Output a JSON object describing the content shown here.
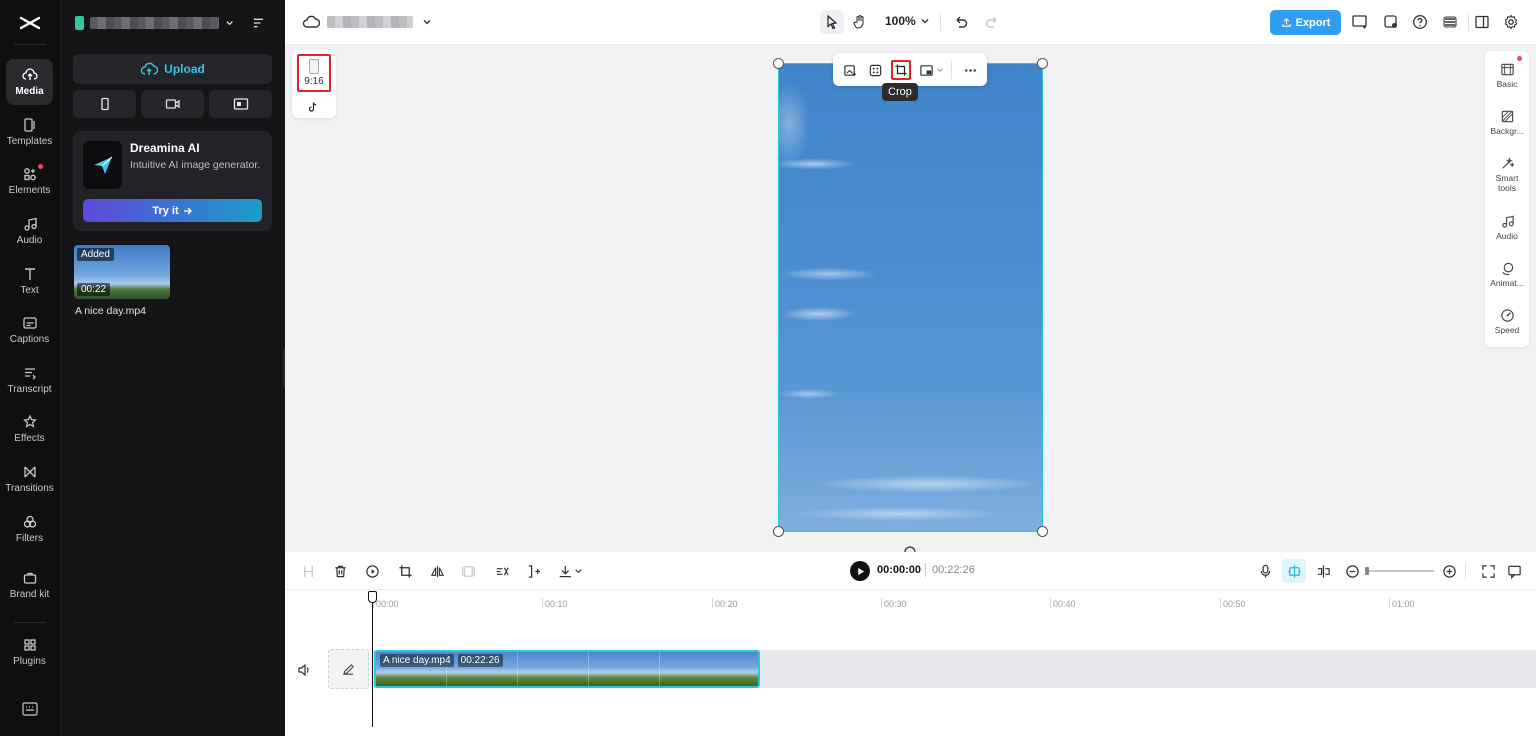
{
  "rail": {
    "items": [
      {
        "label": "Media",
        "icon": "cloud-upload-icon"
      },
      {
        "label": "Templates",
        "icon": "templates-icon"
      },
      {
        "label": "Elements",
        "icon": "elements-icon"
      },
      {
        "label": "Audio",
        "icon": "music-note-icon"
      },
      {
        "label": "Text",
        "icon": "text-icon"
      },
      {
        "label": "Captions",
        "icon": "captions-icon"
      },
      {
        "label": "Transcript",
        "icon": "transcript-icon"
      },
      {
        "label": "Effects",
        "icon": "effects-icon"
      },
      {
        "label": "Transitions",
        "icon": "transitions-icon"
      },
      {
        "label": "Filters",
        "icon": "filters-icon"
      },
      {
        "label": "Brand kit",
        "icon": "brand-kit-icon"
      },
      {
        "label": "Plugins",
        "icon": "plugins-icon"
      }
    ]
  },
  "panel": {
    "upload_label": "Upload",
    "promo": {
      "title": "Dreamina AI",
      "subtitle": "Intuitive AI image generator.",
      "button": "Try it"
    },
    "media": {
      "badge": "Added",
      "duration": "00:22",
      "name": "A nice day.mp4"
    }
  },
  "topbar": {
    "zoom": "100%",
    "export_label": "Export"
  },
  "stage": {
    "ratio_label": "9:16",
    "tooltip": "Crop",
    "right_rail": [
      {
        "label": "Basic",
        "icon": "basic-icon"
      },
      {
        "label": "Backgr...",
        "icon": "background-icon"
      },
      {
        "label": "Smart tools",
        "icon": "smart-tools-icon"
      },
      {
        "label": "Audio",
        "icon": "audio-icon"
      },
      {
        "label": "Animat...",
        "icon": "animation-icon"
      },
      {
        "label": "Speed",
        "icon": "speed-icon"
      }
    ]
  },
  "timeline": {
    "current_time": "00:00:00",
    "total_time": "00:22:26",
    "ruler": [
      "00:00",
      "00:10",
      "00:20",
      "00:30",
      "00:40",
      "00:50",
      "01:00"
    ],
    "clip": {
      "name": "A nice day.mp4",
      "duration": "00:22:26"
    }
  },
  "colors": {
    "accent": "#2ec5d8",
    "export": "#2f9df0",
    "highlight": "#e0262a"
  }
}
